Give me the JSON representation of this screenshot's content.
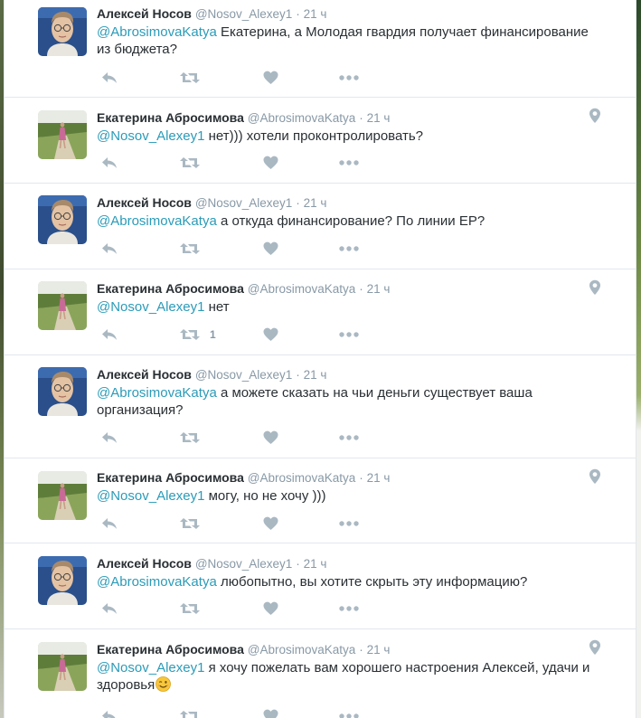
{
  "icons": {
    "reply": "reply-icon",
    "retweet": "retweet-icon",
    "like": "heart-icon",
    "more": "more-icon",
    "geo": "location-pin-icon",
    "emoji": "winking-face-emoji"
  },
  "colors": {
    "mention": "#2b9bb8",
    "name": "#292f33",
    "meta": "#8899a6",
    "action_icon": "#aab8c2"
  },
  "tweets": [
    {
      "author": "alexey",
      "fullname": "Алексей Носов",
      "username": "@Nosov_Alexey1",
      "dot": "·",
      "time": "21 ч",
      "mention": "@AbrosimovaKatya",
      "text": " Екатерина, а Молодая гвардия получает финансирование из бюджета?",
      "retweet_count": "",
      "has_geo": false
    },
    {
      "author": "ekaterina",
      "fullname": "Екатерина Абросимова",
      "username": "@AbrosimovaKatya",
      "dot": "·",
      "time": "21 ч",
      "mention": "@Nosov_Alexey1",
      "text": " нет))) хотели проконтролировать?",
      "retweet_count": "",
      "has_geo": true
    },
    {
      "author": "alexey",
      "fullname": "Алексей Носов",
      "username": "@Nosov_Alexey1",
      "dot": "·",
      "time": "21 ч",
      "mention": "@AbrosimovaKatya",
      "text": " а откуда финансирование? По линии ЕР?",
      "retweet_count": "",
      "has_geo": false
    },
    {
      "author": "ekaterina",
      "fullname": "Екатерина Абросимова",
      "username": "@AbrosimovaKatya",
      "dot": "·",
      "time": "21 ч",
      "mention": "@Nosov_Alexey1",
      "text": " нет",
      "retweet_count": "1",
      "has_geo": true
    },
    {
      "author": "alexey",
      "fullname": "Алексей Носов",
      "username": "@Nosov_Alexey1",
      "dot": "·",
      "time": "21 ч",
      "mention": "@AbrosimovaKatya",
      "text": " а можете сказать на чьи деньги существует ваша организация?",
      "retweet_count": "",
      "has_geo": false
    },
    {
      "author": "ekaterina",
      "fullname": "Екатерина Абросимова",
      "username": "@AbrosimovaKatya",
      "dot": "·",
      "time": "21 ч",
      "mention": "@Nosov_Alexey1",
      "text": " могу, но не хочу )))",
      "retweet_count": "",
      "has_geo": true
    },
    {
      "author": "alexey",
      "fullname": "Алексей Носов",
      "username": "@Nosov_Alexey1",
      "dot": "·",
      "time": "21 ч",
      "mention": "@AbrosimovaKatya",
      "text": " любопытно, вы хотите скрыть эту информацию?",
      "retweet_count": "",
      "has_geo": false
    },
    {
      "author": "ekaterina",
      "fullname": "Екатерина Абросимова",
      "username": "@AbrosimovaKatya",
      "dot": "·",
      "time": "21 ч",
      "mention": "@Nosov_Alexey1",
      "text": " я хочу пожелать вам хорошего настроения Алексей, удачи и здоровья",
      "retweet_count": "",
      "has_geo": true,
      "emoji": "winking-face-emoji"
    }
  ]
}
